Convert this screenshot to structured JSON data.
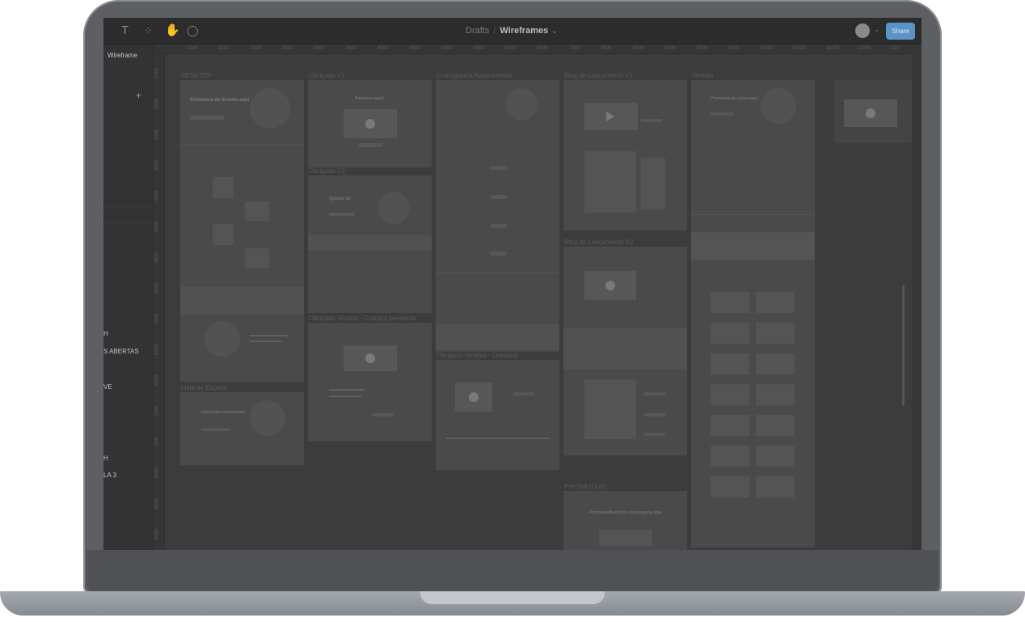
{
  "toolbar": {
    "tools": [
      {
        "name": "text-tool-icon",
        "glyph": "T"
      },
      {
        "name": "resources-icon",
        "glyph": "⁘"
      },
      {
        "name": "hand-tool-icon",
        "glyph": "✋"
      },
      {
        "name": "comment-tool-icon",
        "glyph": "◯"
      }
    ],
    "breadcrumb": {
      "root": "Drafts",
      "separator": "/",
      "file": "Wireframes",
      "caret": "⌄"
    },
    "avatar_caret": "⌄",
    "share_label": "Share"
  },
  "left_panel": {
    "page_label": "Wireframe",
    "add_glyph": "+",
    "layers": [
      "H",
      "S ABERTAS",
      "VE",
      "H",
      "LA 3"
    ]
  },
  "ruler": {
    "top": [
      "1000",
      "1500",
      "2000",
      "2500",
      "3000",
      "3500",
      "4000",
      "4500",
      "5000",
      "5500",
      "6000",
      "6500",
      "7000",
      "7500",
      "8000",
      "8500",
      "9000",
      "9500",
      "10000",
      "10500",
      "11000",
      "11500",
      "120"
    ],
    "left": [
      "1500",
      "2000",
      "2500",
      "3000",
      "3500",
      "4000",
      "4500",
      "5000",
      "5500",
      "6000",
      "6500",
      "7000",
      "7500",
      "8000",
      "8500",
      "9000"
    ]
  },
  "frames": {
    "desktop": "DESKTOP",
    "obrigado_v1": "Obrigado V1",
    "obrigado_v2": "Obrigado V2",
    "obrigado_vendas_compra": "Obrigado Vendas - Compra pendente",
    "cronograma": "Cronograma/Aquecimento",
    "obrigado_vendas_onboard": "Obrigado Vendas - Onboard",
    "blog_v1": "Blog de Lançamento V1",
    "blog_v2": "Blog de Lançamento V2",
    "pre_sell": "Pré-Sell (Quiz)",
    "vendas": "Vendas",
    "lista_espera": "Lista de Espera"
  },
  "frame_text": {
    "promessa_evento": "Promessa do Evento aqui",
    "parabens": "Parabéns aqui!",
    "quase_la": "Quase lá!",
    "promessa_curso": "Promessa do curso aqui.",
    "inscricao": "Inscrições encerradas!",
    "promessa_quiz": "Promessa/Benefício da pergunta aqui"
  },
  "colors": {
    "screen_bg": "#3a3a3a",
    "frame_bg": "#4a4a4a",
    "share_button": "#5b93c7"
  }
}
